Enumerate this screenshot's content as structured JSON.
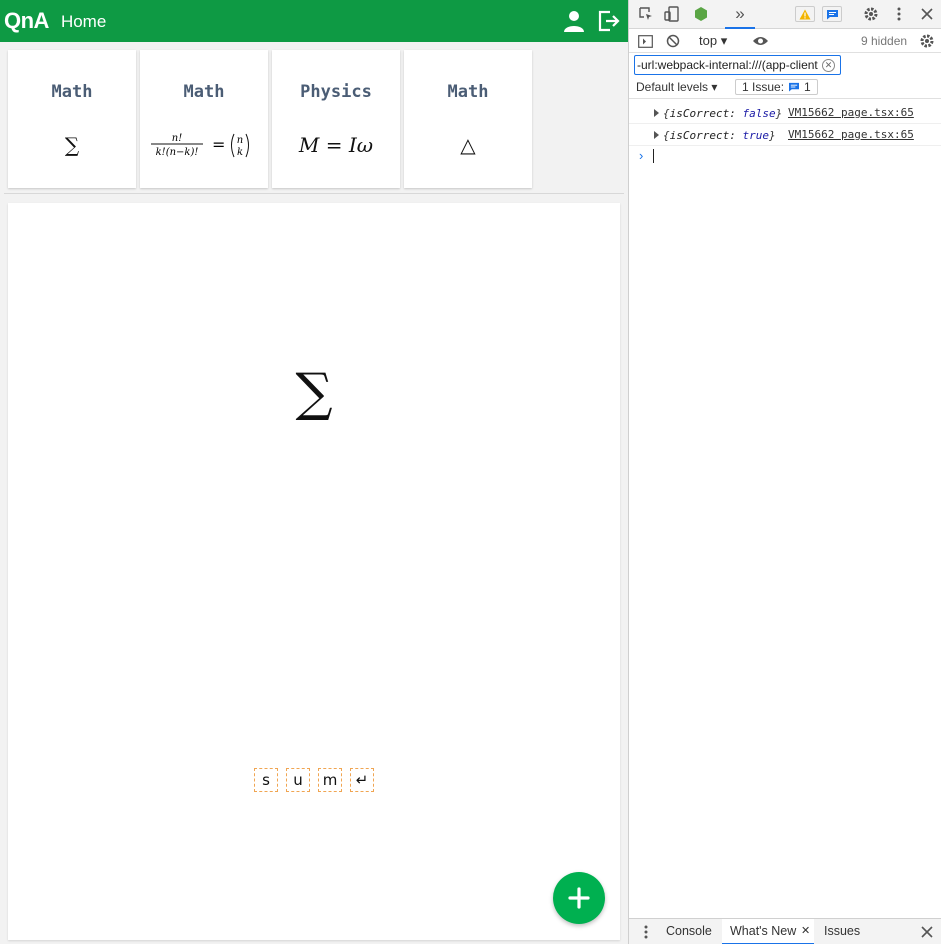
{
  "app": {
    "brand": "QnA",
    "home": "Home",
    "cards": [
      {
        "subject": "Math",
        "formula": "∑"
      },
      {
        "subject": "Math",
        "formula": "binomial"
      },
      {
        "subject": "Physics",
        "formula": "M = Iω"
      },
      {
        "subject": "Math",
        "formula": "△"
      }
    ],
    "main_symbol": "∑",
    "keys": [
      "s",
      "u",
      "m",
      "↵"
    ],
    "fab_label": "+"
  },
  "devtools": {
    "context": "top",
    "hidden_count": "9 hidden",
    "filter_value": "-url:webpack-internal:///(app-client",
    "levels": "Default levels",
    "issues_label": "1 Issue:",
    "issues_count": "1",
    "logs": [
      {
        "key": "isCorrect:",
        "value": "false",
        "source": "VM15662 page.tsx:65"
      },
      {
        "key": "isCorrect:",
        "value": "true",
        "source": "VM15662 page.tsx:65"
      }
    ],
    "drawer_tabs": [
      "Console",
      "What's New",
      "Issues"
    ]
  },
  "colors": {
    "navbar": "#0e9a44",
    "fab": "#00b050",
    "key_border": "#f0a552",
    "devtools_accent": "#1a73e8"
  }
}
